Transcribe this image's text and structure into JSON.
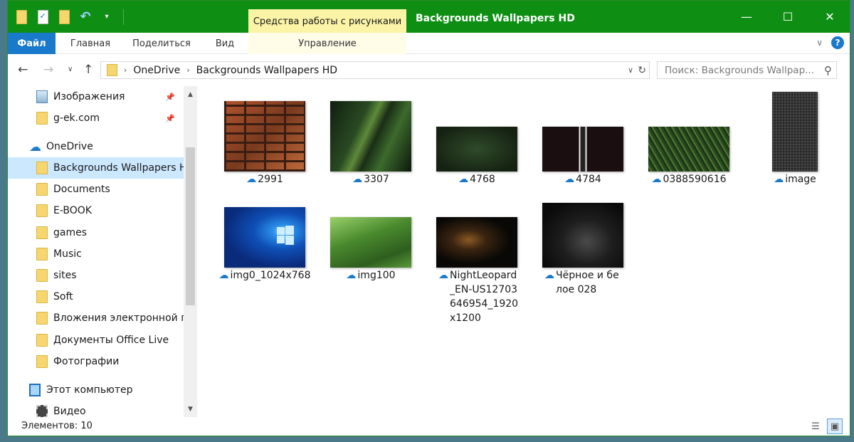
{
  "window": {
    "title": "Backgrounds Wallpapers HD",
    "context_tab_group": "Средства работы с рисунками",
    "controls": {
      "minimize": "—",
      "maximize": "☐",
      "close": "✕"
    }
  },
  "quick_access_toolbar": {
    "icons": [
      "folder-icon",
      "properties-icon",
      "new-folder-icon",
      "undo-icon",
      "chevron-down-icon"
    ]
  },
  "ribbon": {
    "tabs": [
      "Файл",
      "Главная",
      "Поделиться",
      "Вид",
      "Управление"
    ],
    "expand_symbol": "∨",
    "help_symbol": "?"
  },
  "address_bar": {
    "breadcrumbs": [
      "OneDrive",
      "Backgrounds Wallpapers HD"
    ],
    "search_placeholder": "Поиск: Backgrounds Wallpap..."
  },
  "nav_pane": {
    "items": [
      {
        "label": "Изображения",
        "icon": "pictures-icon",
        "pinned": true
      },
      {
        "label": "g-ek.com",
        "icon": "folder-icon",
        "pinned": true
      },
      {
        "label": "OneDrive",
        "icon": "cloud-icon"
      },
      {
        "label": "Backgrounds Wallpapers HD",
        "icon": "folder-icon",
        "selected": true
      },
      {
        "label": "Documents",
        "icon": "folder-icon"
      },
      {
        "label": "E-BOOK",
        "icon": "folder-icon"
      },
      {
        "label": "games",
        "icon": "folder-icon"
      },
      {
        "label": "Music",
        "icon": "folder-icon"
      },
      {
        "label": "sites",
        "icon": "folder-icon"
      },
      {
        "label": "Soft",
        "icon": "folder-icon"
      },
      {
        "label": "Вложения электронной почты",
        "icon": "folder-icon"
      },
      {
        "label": "Документы Office Live",
        "icon": "folder-icon"
      },
      {
        "label": "Фотографии",
        "icon": "folder-icon"
      },
      {
        "label": "Этот компьютер",
        "icon": "computer-icon"
      },
      {
        "label": "Видео",
        "icon": "video-icon"
      }
    ]
  },
  "files": [
    {
      "name": "2991",
      "thumb": "brick-wall"
    },
    {
      "name": "3307",
      "thumb": "grass-closeup"
    },
    {
      "name": "4768",
      "thumb": "dark-green"
    },
    {
      "name": "4784",
      "thumb": "suit"
    },
    {
      "name": "0388590616",
      "thumb": "grass-field"
    },
    {
      "name": "image",
      "thumb": "dark-texture"
    },
    {
      "name": "img0_1024x768",
      "thumb": "windows-logo"
    },
    {
      "name": "img100",
      "thumb": "green-valley"
    },
    {
      "name": "NightLeopard_EN-US12703646954_1920x1200",
      "thumb": "leopard"
    },
    {
      "name": "Чёрное и белое 028",
      "thumb": "black-white-abstract"
    }
  ],
  "status": {
    "items_count": "Элементов: 10"
  },
  "colors": {
    "titlebar": "#0e8f14",
    "accent": "#1979ca",
    "context_tab": "#fbf4a6",
    "selection": "#cce8ff"
  }
}
